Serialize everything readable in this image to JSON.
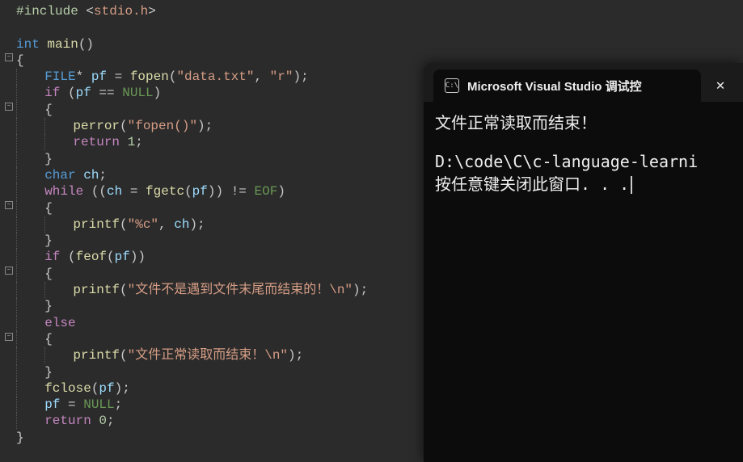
{
  "code": {
    "include": "#include <stdio.h>",
    "main_decl": {
      "type": "int",
      "name": "main",
      "parens": "()"
    },
    "file_decl": {
      "type": "FILE",
      "var": "pf",
      "func": "fopen",
      "arg1": "\"data.txt\"",
      "arg2": "\"r\""
    },
    "if_null": {
      "kw": "if",
      "var": "pf",
      "cmp": "==",
      "null": "NULL"
    },
    "perror": {
      "func": "perror",
      "arg": "\"fopen()\""
    },
    "return1": {
      "kw": "return",
      "val": "1"
    },
    "char_ch": {
      "type": "char",
      "var": "ch"
    },
    "while": {
      "kw": "while",
      "var1": "ch",
      "func": "fgetc",
      "arg": "pf",
      "neq": "!=",
      "eof": "EOF"
    },
    "printf_c": {
      "func": "printf",
      "fmt": "\"%c\"",
      "arg": "ch"
    },
    "if_feof": {
      "kw": "if",
      "func": "feof",
      "arg": "pf"
    },
    "printf_err": {
      "func": "printf",
      "arg": "\"文件不是遇到文件末尾而结束的！\\n\""
    },
    "else": {
      "kw": "else"
    },
    "printf_ok": {
      "func": "printf",
      "arg": "\"文件正常读取而结束！\\n\""
    },
    "fclose": {
      "func": "fclose",
      "arg": "pf"
    },
    "pf_null": {
      "var": "pf",
      "null": "NULL"
    },
    "return0": {
      "kw": "return",
      "val": "0"
    }
  },
  "console": {
    "title": "Microsoft Visual Studio 调试控",
    "line1": "文件正常读取而结束！",
    "line2": "D:\\code\\C\\c-language-learni",
    "line3": "按任意键关闭此窗口. . ."
  },
  "icons": {
    "cmd": "C:\\",
    "close": "✕"
  }
}
